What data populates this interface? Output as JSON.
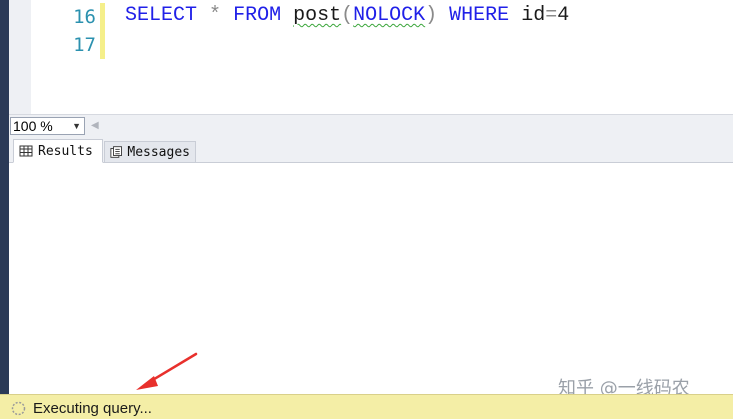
{
  "editor": {
    "lines": [
      {
        "number": "16",
        "tokens": [
          {
            "text": "SELECT",
            "kind": "keyword"
          },
          {
            "text": " ",
            "kind": "text"
          },
          {
            "text": "*",
            "kind": "operator"
          },
          {
            "text": " ",
            "kind": "text"
          },
          {
            "text": "FROM",
            "kind": "keyword"
          },
          {
            "text": " ",
            "kind": "text"
          },
          {
            "text": "post",
            "kind": "squiggle"
          },
          {
            "text": "(",
            "kind": "operator"
          },
          {
            "text": "NOLOCK",
            "kind": "keyword-squiggle"
          },
          {
            "text": ")",
            "kind": "operator"
          },
          {
            "text": " ",
            "kind": "text"
          },
          {
            "text": "WHERE",
            "kind": "keyword"
          },
          {
            "text": " id",
            "kind": "text"
          },
          {
            "text": "=",
            "kind": "operator"
          },
          {
            "text": "4",
            "kind": "text"
          }
        ]
      },
      {
        "number": "17",
        "tokens": []
      }
    ]
  },
  "zoom": {
    "value": "100 %"
  },
  "tabs": {
    "results_label": "Results",
    "messages_label": "Messages"
  },
  "status": {
    "text": "Executing query..."
  },
  "watermark": {
    "text": "知乎 @一线码农"
  },
  "colors": {
    "keyword": "#2020e8",
    "status_bar": "#f4eea6",
    "annotation_arrow": "#e8302c",
    "line_number": "#2b91af"
  }
}
